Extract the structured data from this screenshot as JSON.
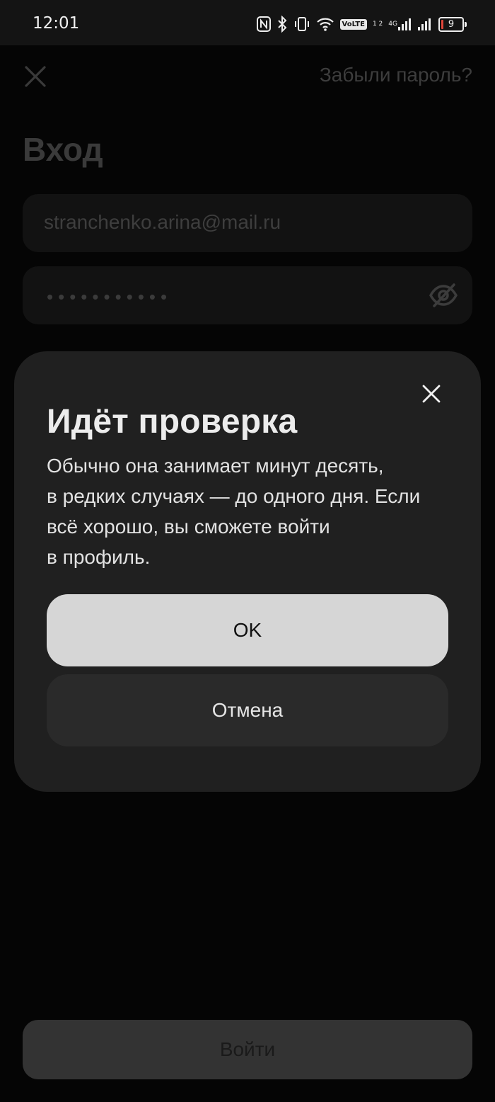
{
  "status_bar": {
    "time": "12:01",
    "volte": "VoLTE",
    "sim_slots": "1 2",
    "net_type": "4G",
    "battery": "9",
    "icons": [
      "nfc-icon",
      "bluetooth-icon",
      "vibrate-icon",
      "wifi-icon",
      "volte-icon",
      "signal-icon",
      "signal-icon",
      "battery-icon"
    ]
  },
  "background": {
    "close_icon": "close-icon",
    "forgot_password": "Забыли пароль?",
    "title": "Вход",
    "email_value": "stranchenko.arina@mail.ru",
    "password_mask": "•••••••••••",
    "password_toggle_icon": "eye-off-icon",
    "login_button": "Войти"
  },
  "dialog": {
    "title": "Идёт проверка",
    "body_lines": [
      "Обычно она занимает минут десять,",
      "в редких случаях — до одного дня. Если",
      "всё хорошо, вы сможете войти",
      "в профиль."
    ],
    "ok_label": "OK",
    "cancel_label": "Отмена",
    "close_icon": "close-icon"
  },
  "colors": {
    "background": "#050505",
    "dialog": "#202020",
    "ok_button": "#d6d6d6",
    "cancel_button": "#2a2a2a",
    "battery_low": "#e0463a"
  }
}
